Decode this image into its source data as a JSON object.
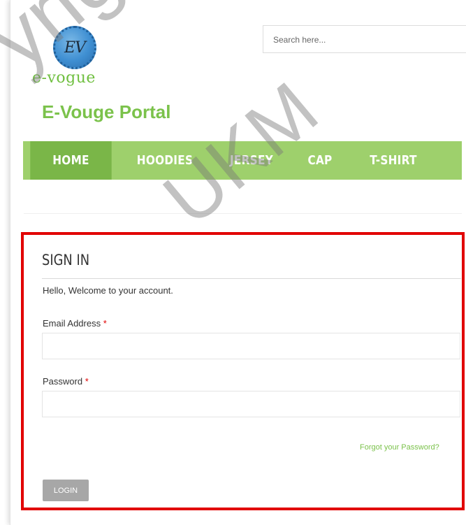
{
  "logo": {
    "monogram": "EV",
    "brand_text": "e-vogue"
  },
  "site_title": "E-Vouge Portal",
  "search": {
    "placeholder": "Search here..."
  },
  "nav": {
    "items": [
      {
        "label": "HOME",
        "active": true
      },
      {
        "label": "HOODIES"
      },
      {
        "label": "JERSEY"
      },
      {
        "label": "CAP"
      },
      {
        "label": "T-SHIRT"
      }
    ]
  },
  "signin": {
    "title": "SIGN IN",
    "welcome": "Hello, Welcome to your account.",
    "email_label": "Email Address",
    "password_label": "Password",
    "required_mark": "*",
    "forgot_link": "Forgot your Password?",
    "login_button": "LOGIN"
  },
  "watermark": {
    "line1": "yright",
    "line2": "UKM"
  },
  "colors": {
    "brand_green": "#7bc24b",
    "nav_bg": "#9ed06c",
    "nav_active": "#7ab648",
    "highlight_red": "#e10000",
    "button_gray": "#a7a7a7"
  }
}
